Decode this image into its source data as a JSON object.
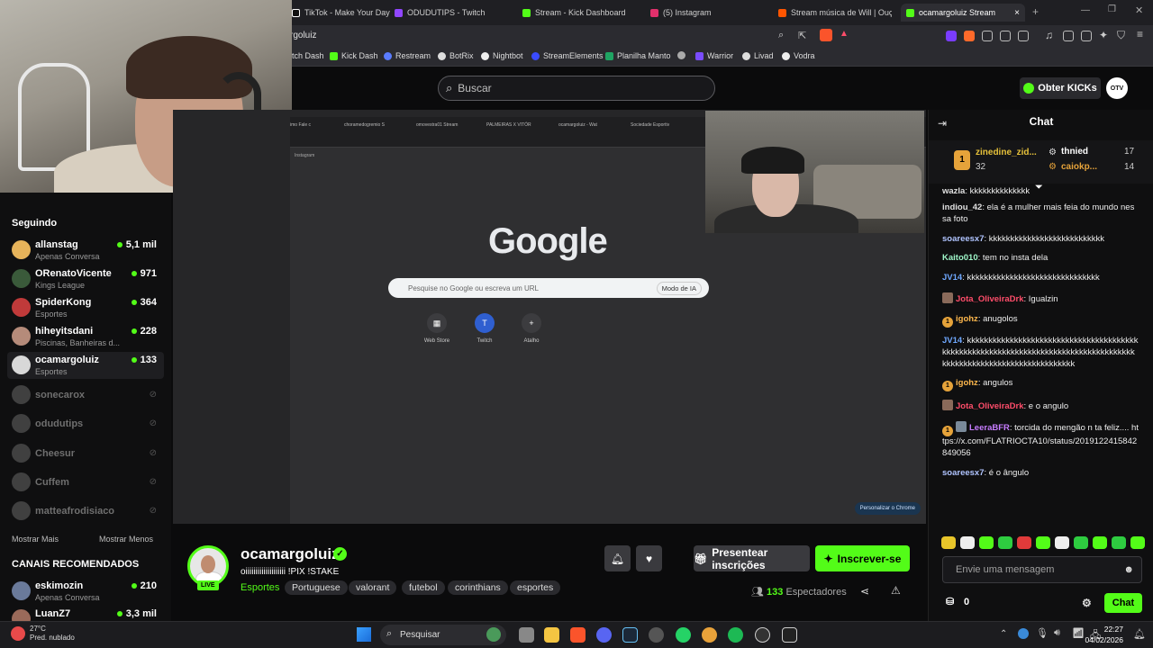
{
  "browser": {
    "tabs": [
      "TikTok - Make Your Day",
      "ODUDUTIPS - Twitch",
      "Stream - Kick Dashboard",
      "(5) Instagram",
      "Stream música de Will | Ouça",
      "ocamargoluiz Stream"
    ],
    "url": "rgoluiz",
    "bookmarks": [
      "tch Dash",
      "Kick Dash",
      "Restream",
      "BotRix",
      "Nightbot",
      "StreamElements",
      "Planilha Manto",
      "Warrior",
      "Livad",
      "Vodra"
    ],
    "colors": {
      "kick_green": "#53fc18"
    }
  },
  "header": {
    "search_placeholder": "Buscar",
    "kicks_button": "Obter KICKs",
    "avatar_label": "OTV"
  },
  "sidebar": {
    "following_title": "Seguindo",
    "following": [
      {
        "name": "allanstag",
        "sub": "Apenas Conversa",
        "viewers": "5,1 mil",
        "color": "#e6b35a"
      },
      {
        "name": "ORenatoVicente",
        "sub": "Kings League",
        "viewers": "971",
        "color": "#3a5a3a"
      },
      {
        "name": "SpiderKong",
        "sub": "Esportes",
        "viewers": "364",
        "color": "#c03a3a"
      },
      {
        "name": "hiheyitsdani",
        "sub": "Piscinas, Banheiras d...",
        "viewers": "228",
        "color": "#b58b7a"
      },
      {
        "name": "ocamargoluiz",
        "sub": "Esportes",
        "viewers": "133",
        "color": "#d8d8d8"
      }
    ],
    "offline": [
      "sonecarox",
      "odudutips",
      "Cheesur",
      "Cuffem",
      "matteafrodisiaco"
    ],
    "show_more": "Mostrar Mais",
    "show_less": "Mostrar Menos",
    "recommended_title": "CANAIS RECOMENDADOS",
    "recommended": [
      {
        "name": "eskimozin",
        "sub": "Apenas Conversa",
        "viewers": "210",
        "color": "#6a7a9a"
      },
      {
        "name": "LuanZ7",
        "sub": "",
        "viewers": "3,3 mil",
        "color": "#9a6a5a"
      }
    ]
  },
  "stream_screen": {
    "inner_tabs": [
      "imo Fale c",
      "choramedogremio S",
      "omovestra01 Stream",
      "PALMEIRAS X VITÓR",
      "ocamargoluiz - Wat",
      "Sociedade Esportiv"
    ],
    "inner_label": "Instagram",
    "google": "Google",
    "search_placeholder": "Pesquise no Google ou escreva um URL",
    "ai_mode": "Modo de IA",
    "shortcuts": [
      "Web Store",
      "Twitch",
      "Atalho"
    ],
    "personalize": "Personalizar o Chrome"
  },
  "channel": {
    "name": "ocamargoluiz",
    "title": "oiiiiiiiiiiiiiiiiiiii !PIX  !STAKE",
    "category": "Esportes",
    "tags": [
      "Portuguese",
      "valorant",
      "futebol",
      "corinthians",
      "esportes"
    ],
    "live": "LIVE",
    "gift_button": "Presentear inscrições",
    "subscribe_button": "Inscrever-se",
    "viewers_count": "133",
    "viewers_label": "Espectadores"
  },
  "chat": {
    "title": "Chat",
    "pinned": [
      {
        "name": "zinedine_zid...",
        "count": "32",
        "rank": "1"
      },
      {
        "name": "thnied",
        "count": "17"
      },
      {
        "name": "caiokp...",
        "count": "14"
      }
    ],
    "messages": [
      {
        "user": "wazla",
        "text": "kkkkkkkkkkkkkk",
        "color": "#e0e0e0",
        "badge": ""
      },
      {
        "user": "indiou_42",
        "text": "ela é a mulher mais feia do mundo nessa foto",
        "color": "#e0e0e0",
        "badge": ""
      },
      {
        "user": "soareesx7",
        "text": "kkkkkkkkkkkkkkkkkkkkkkkkkkk",
        "color": "#b0c4ff",
        "badge": ""
      },
      {
        "user": "Kaito010",
        "text": "tem no insta dela",
        "color": "#9ef5c8",
        "badge": ""
      },
      {
        "user": "JV14",
        "text": "kkkkkkkkkkkkkkkkkkkkkkkkkkkkkkk",
        "color": "#6fa8ff",
        "badge": ""
      },
      {
        "user": "Jota_OliveiraDrk",
        "text": "Igualzin",
        "color": "#ff4d6a",
        "badge": "img"
      },
      {
        "user": "igohz",
        "text": "anugolos",
        "color": "#ffb84d",
        "badge": "1"
      },
      {
        "user": "JV14",
        "text": "kkkkkkkkkkkkkkkkkkkkkkkkkkkkkkkkkkkkkkkkkkkkkkkkkkkkkkkkkkkkkkkkkkkkkkkkkkkkkkkkkkkkkkkkkkkkkkkkkkkkkkkkkkkkkkkkkkkk",
        "color": "#6fa8ff",
        "badge": ""
      },
      {
        "user": "igohz",
        "text": "angulos",
        "color": "#ffb84d",
        "badge": "1"
      },
      {
        "user": "Jota_OliveiraDrk",
        "text": "e o angulo",
        "color": "#ff4d6a",
        "badge": "img"
      },
      {
        "user": "LeeraBFR",
        "text": "torcida do mengão n ta feliz.... https://x.com/FLATRIOCTA10/status/2019122415842849056",
        "color": "#c77dff",
        "badge": "1"
      },
      {
        "user": "soareesx7",
        "text": "é o ângulo",
        "color": "#b0c4ff",
        "badge": ""
      }
    ],
    "input_placeholder": "Envie uma mensagem",
    "kicks_balance": "0",
    "send_button": "Chat"
  },
  "taskbar": {
    "temperature": "27°C",
    "weather": "Pred. nublado",
    "search": "Pesquisar",
    "time": "22:27",
    "date": "04/02/2026"
  }
}
